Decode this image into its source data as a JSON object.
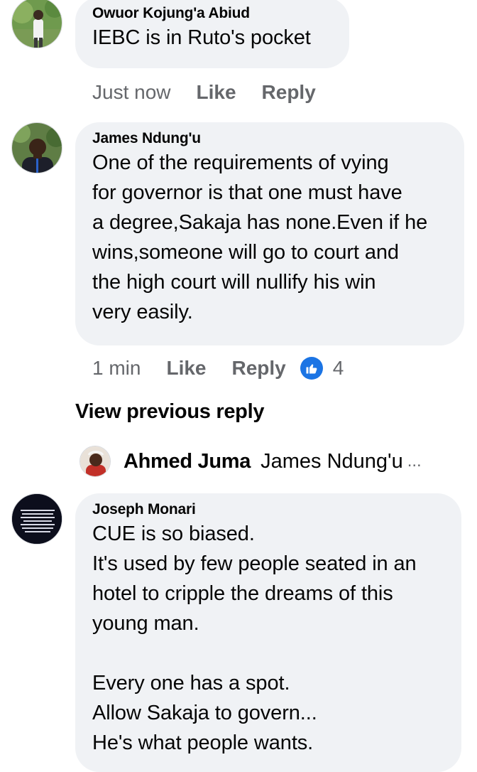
{
  "comments": [
    {
      "author": "Owuor Kojung'a Abiud",
      "text": "IEBC is in Ruto's  pocket",
      "time": "Just now",
      "like_label": "Like",
      "reply_label": "Reply"
    },
    {
      "author": "James Ndung'u",
      "text": "One of the requirements of vying\nfor governor is that one must have\na degree,Sakaja has none.Even if he\nwins,someone will go to court and\nthe high court will nullify his win\nvery easily.",
      "time": "1 min",
      "like_label": "Like",
      "reply_label": "Reply",
      "reaction_count": "4"
    },
    {
      "author": "Joseph Monari",
      "text": "CUE is so biased.\nIt's used by few people seated in an\nhotel to cripple the dreams of this\nyoung man.\n\nEvery one has a spot.\nAllow Sakaja to govern...\nHe's what people wants."
    }
  ],
  "view_previous_reply": "View previous reply",
  "reply_preview": {
    "author": "Ahmed Juma",
    "text": "James Ndung'u",
    "ellipsis": "..."
  },
  "icons": {
    "like_reaction": "thumbs-up-icon",
    "reaction_color": "#1b74e4"
  }
}
